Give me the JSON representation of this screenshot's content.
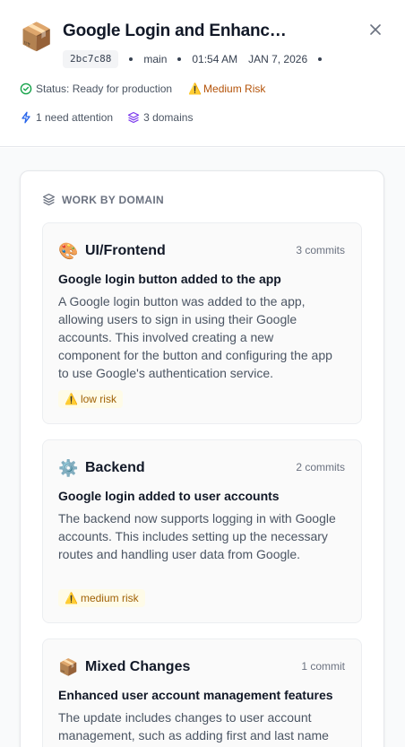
{
  "header": {
    "app_icon": "package-icon",
    "title": "Google Login and Enhanced User Management",
    "commit_hash": "2bc7c88",
    "branch": "main",
    "time": "01:54 AM",
    "date": "JAN 7, 2026",
    "status_label": "Status: Ready for production",
    "risk_label": "Medium Risk",
    "attention_label": "1 need attention",
    "domains_label": "3 domains"
  },
  "panel": {
    "heading": "WORK BY DOMAIN"
  },
  "domains": [
    {
      "emoji": "🎨",
      "name": "UI/Frontend",
      "commits": "3 commits",
      "summary": "Google login button added to the app",
      "description": "A Google login button was added to the app, allowing users to sign in using their Google accounts. This involved creating a new component for the button and configuring the app to use Google's authentication service.",
      "risk": "low risk"
    },
    {
      "emoji": "⚙️",
      "name": "Backend",
      "commits": "2 commits",
      "summary": "Google login added to user accounts",
      "description": "The backend now supports logging in with Google accounts. This includes setting up the necessary routes and handling user data from Google.",
      "risk": "medium risk"
    },
    {
      "emoji": "📦",
      "name": "Mixed Changes",
      "commits": "1 commit",
      "summary": "Enhanced user account management features",
      "description": "The update includes changes to user account management, such as adding first and last name fields",
      "risk": ""
    }
  ],
  "colors": {
    "status_ok": "#16a34a",
    "risk_medium": "#b45309",
    "attention": "#2563eb",
    "domains": "#7c3aed"
  }
}
